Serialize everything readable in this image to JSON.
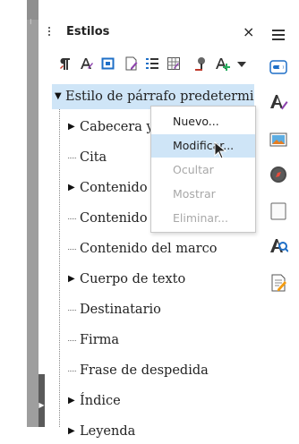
{
  "deck": {
    "title": "Estilos",
    "close_glyph": "×"
  },
  "toolbar": {
    "icons": [
      "paragraph-styles-icon",
      "character-styles-icon",
      "frame-styles-icon",
      "page-styles-icon",
      "list-styles-icon",
      "table-styles-icon",
      "fill-format-mode-icon",
      "new-style-icon",
      "style-actions-dropdown-icon"
    ]
  },
  "tree": {
    "root": {
      "label": "Estilo de párrafo predeterminado",
      "expanded": true,
      "selected": true
    },
    "items": [
      {
        "label": "Cabecera y pie",
        "expandable": true
      },
      {
        "label": "Cita",
        "expandable": false
      },
      {
        "label": "Contenido de la tabla",
        "expandable": true
      },
      {
        "label": "Contenido de la lista",
        "expandable": false
      },
      {
        "label": "Contenido del marco",
        "expandable": false
      },
      {
        "label": "Cuerpo de texto",
        "expandable": true
      },
      {
        "label": "Destinatario",
        "expandable": false
      },
      {
        "label": "Firma",
        "expandable": false
      },
      {
        "label": "Frase de despedida",
        "expandable": false
      },
      {
        "label": "Índice",
        "expandable": true
      },
      {
        "label": "Leyenda",
        "expandable": true
      }
    ]
  },
  "context_menu": {
    "items": [
      {
        "label": "Nuevo...",
        "enabled": true,
        "hover": false
      },
      {
        "label": "Modificar...",
        "enabled": true,
        "hover": true
      },
      {
        "label": "Ocultar",
        "enabled": false,
        "hover": false
      },
      {
        "label": "Mostrar",
        "enabled": false,
        "hover": false
      },
      {
        "label": "Eliminar...",
        "enabled": false,
        "hover": false
      }
    ]
  },
  "sidebar_tabs": [
    "menu-icon",
    "properties-icon",
    "styles-icon",
    "gallery-icon",
    "navigator-icon",
    "page-icon",
    "style-inspector-icon",
    "manage-changes-icon"
  ],
  "colors": {
    "selection": "#cfe5f7",
    "accent_blue": "#1e6fc7"
  }
}
